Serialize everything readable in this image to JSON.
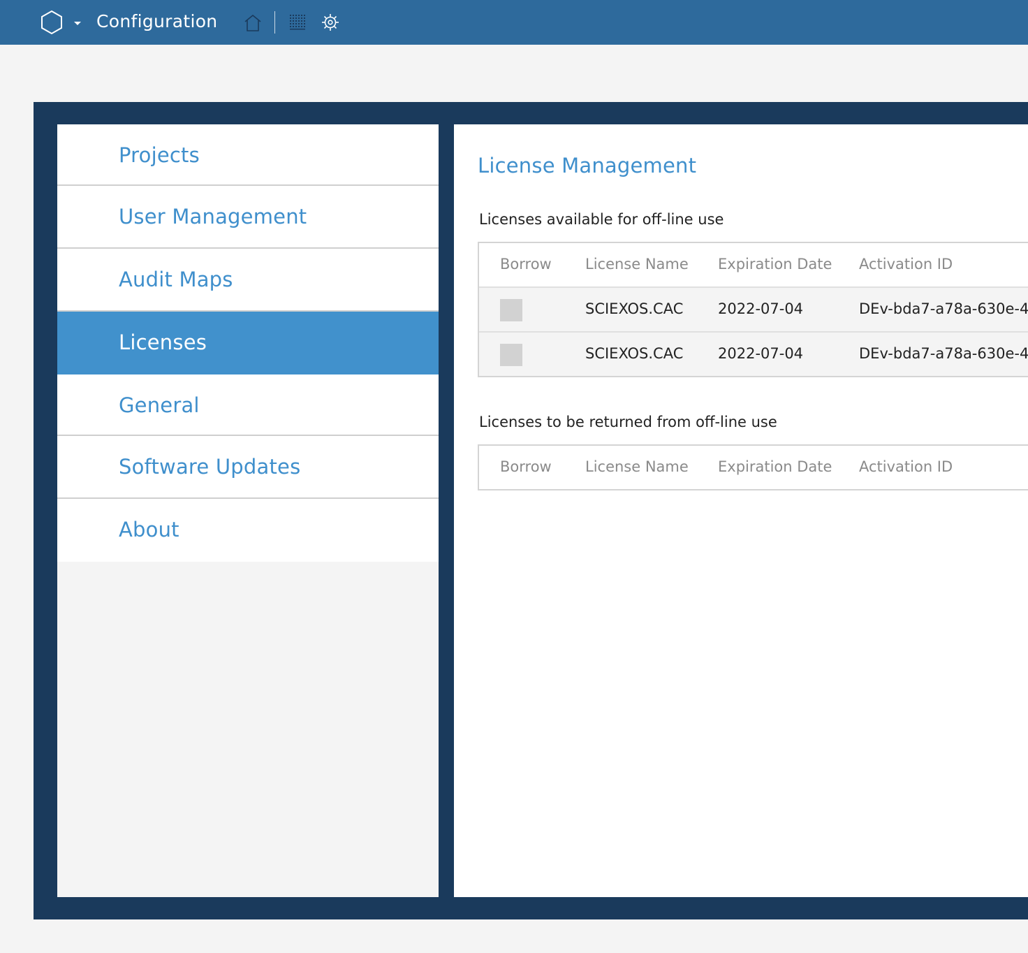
{
  "topbar": {
    "title": "Configuration",
    "icons": [
      "hexagon-logo-icon",
      "caret-down-icon",
      "home-icon",
      "grid-icon",
      "gear-icon"
    ]
  },
  "sidebar": {
    "items": [
      {
        "label": "Projects",
        "active": false
      },
      {
        "label": "User Management",
        "active": false
      },
      {
        "label": "Audit Maps",
        "active": false
      },
      {
        "label": "Licenses",
        "active": true
      },
      {
        "label": "General",
        "active": false
      },
      {
        "label": "Software Updates",
        "active": false
      },
      {
        "label": "About",
        "active": false
      }
    ]
  },
  "content": {
    "title": "License Management",
    "available": {
      "heading": "Licenses available for off-line use",
      "columns": [
        "Borrow",
        "License Name",
        "Expiration Date",
        "Activation ID"
      ],
      "rows": [
        {
          "borrow": false,
          "license_name": "SCIEXOS.CAC",
          "expiration_date": "2022-07-04",
          "activation_id": "DEv-bda7-a78a-630e-4"
        },
        {
          "borrow": false,
          "license_name": "SCIEXOS.CAC",
          "expiration_date": "2022-07-04",
          "activation_id": "DEv-bda7-a78a-630e-4"
        }
      ]
    },
    "returned": {
      "heading": "Licenses to be returned from off-line use",
      "columns": [
        "Borrow",
        "License Name",
        "Expiration Date",
        "Activation ID"
      ],
      "rows": []
    }
  },
  "colors": {
    "topbar": "#2e6a9c",
    "frame": "#1a3a5c",
    "accent": "#3f8fcc",
    "active_nav": "#4191cc"
  }
}
